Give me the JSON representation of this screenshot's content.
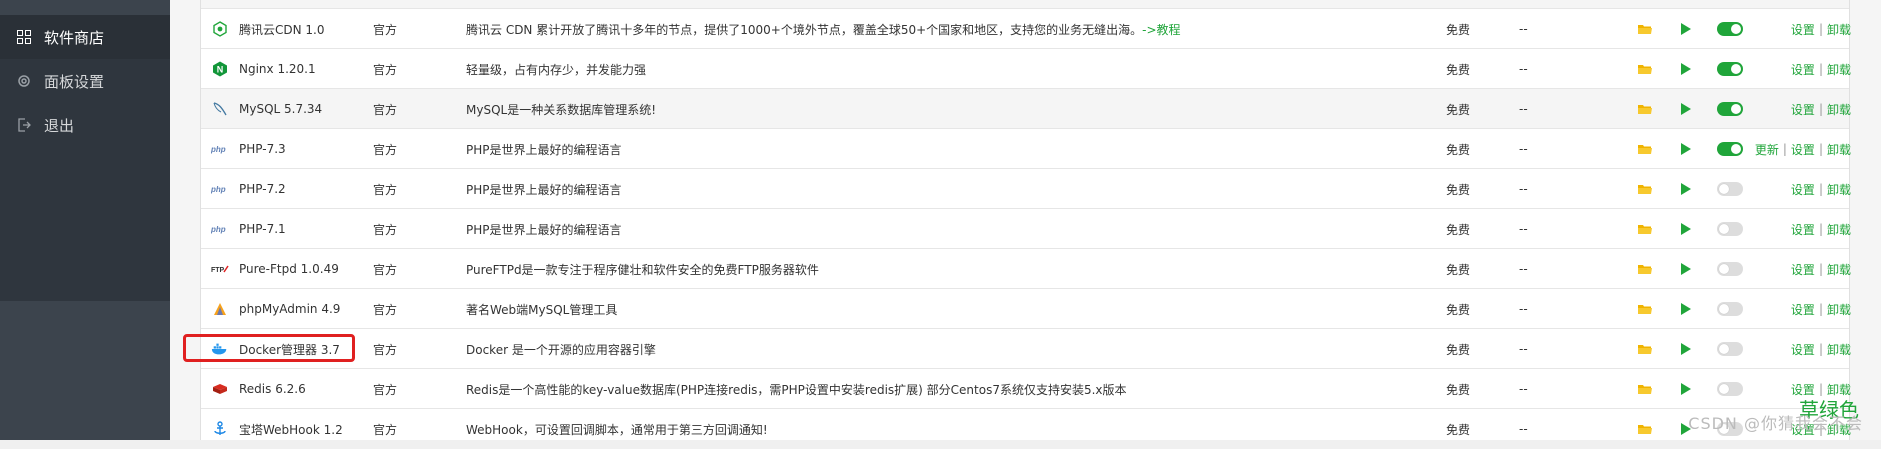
{
  "sidebar": {
    "items": [
      {
        "label": "软件商店",
        "icon": "grid-icon"
      },
      {
        "label": "面板设置",
        "icon": "gear-icon"
      },
      {
        "label": "退出",
        "icon": "logout-icon"
      }
    ]
  },
  "table": {
    "rows": [
      {
        "name": "腾讯云CDN 1.0",
        "logo": "tencent-cdn-logo",
        "dev": "官方",
        "desc": "腾讯云 CDN 累计开放了腾讯十多年的节点，提供了1000+个境外节点，覆盖全球50+个国家和地区，支持您的业务无缝出海。",
        "desc_link": "->教程",
        "price": "免费",
        "expire": "--",
        "toggle": "on",
        "ops": [
          "设置",
          "卸载"
        ]
      },
      {
        "name": "Nginx 1.20.1",
        "logo": "nginx-logo",
        "dev": "官方",
        "desc": "轻量级，占有内存少，并发能力强",
        "price": "免费",
        "expire": "--",
        "toggle": "on",
        "ops": [
          "设置",
          "卸载"
        ]
      },
      {
        "name": "MySQL 5.7.34",
        "logo": "mysql-logo",
        "dev": "官方",
        "desc": "MySQL是一种关系数据库管理系统!",
        "price": "免费",
        "expire": "--",
        "toggle": "on",
        "ops": [
          "设置",
          "卸载"
        ]
      },
      {
        "name": "PHP-7.3",
        "logo": "php-logo",
        "dev": "官方",
        "desc": "PHP是世界上最好的编程语言",
        "price": "免费",
        "expire": "--",
        "toggle": "on",
        "ops": [
          "更新",
          "设置",
          "卸载"
        ]
      },
      {
        "name": "PHP-7.2",
        "logo": "php-logo",
        "dev": "官方",
        "desc": "PHP是世界上最好的编程语言",
        "price": "免费",
        "expire": "--",
        "toggle": "off",
        "ops": [
          "设置",
          "卸载"
        ]
      },
      {
        "name": "PHP-7.1",
        "logo": "php-logo",
        "dev": "官方",
        "desc": "PHP是世界上最好的编程语言",
        "price": "免费",
        "expire": "--",
        "toggle": "off",
        "ops": [
          "设置",
          "卸载"
        ]
      },
      {
        "name": "Pure-Ftpd 1.0.49",
        "logo": "ftp-logo",
        "dev": "官方",
        "desc": "PureFTPd是一款专注于程序健壮和软件安全的免费FTP服务器软件",
        "price": "免费",
        "expire": "--",
        "toggle": "off",
        "ops": [
          "设置",
          "卸载"
        ]
      },
      {
        "name": "phpMyAdmin 4.9",
        "logo": "phpmyadmin-logo",
        "dev": "官方",
        "desc": "著名Web端MySQL管理工具",
        "price": "免费",
        "expire": "--",
        "toggle": "off",
        "ops": [
          "设置",
          "卸载"
        ]
      },
      {
        "name": "Docker管理器 3.7",
        "logo": "docker-logo",
        "dev": "官方",
        "desc": "Docker 是一个开源的应用容器引擎",
        "price": "免费",
        "expire": "--",
        "toggle": "off",
        "ops": [
          "设置",
          "卸载"
        ]
      },
      {
        "name": "Redis 6.2.6",
        "logo": "redis-logo",
        "dev": "官方",
        "desc": "Redis是一个高性能的key-value数据库(PHP连接redis，需PHP设置中安装redis扩展) 部分Centos7系统仅支持安装5.x版本",
        "price": "免费",
        "expire": "--",
        "toggle": "off",
        "ops": [
          "设置",
          "卸载"
        ]
      },
      {
        "name": "宝塔WebHook 1.2",
        "logo": "webhook-logo",
        "dev": "官方",
        "desc": "WebHook，可设置回调脚本，通常用于第三方回调通知!",
        "price": "免费",
        "expire": "--",
        "toggle": "off",
        "ops": [
          "设置",
          "卸载"
        ]
      }
    ]
  },
  "watermark": {
    "brand": "草绿色",
    "text": "CSDN @你猜我会不会"
  },
  "colors": {
    "sidebar_bg": "#3c444d",
    "accent": "#20a53a",
    "highlight": "#e02020"
  }
}
